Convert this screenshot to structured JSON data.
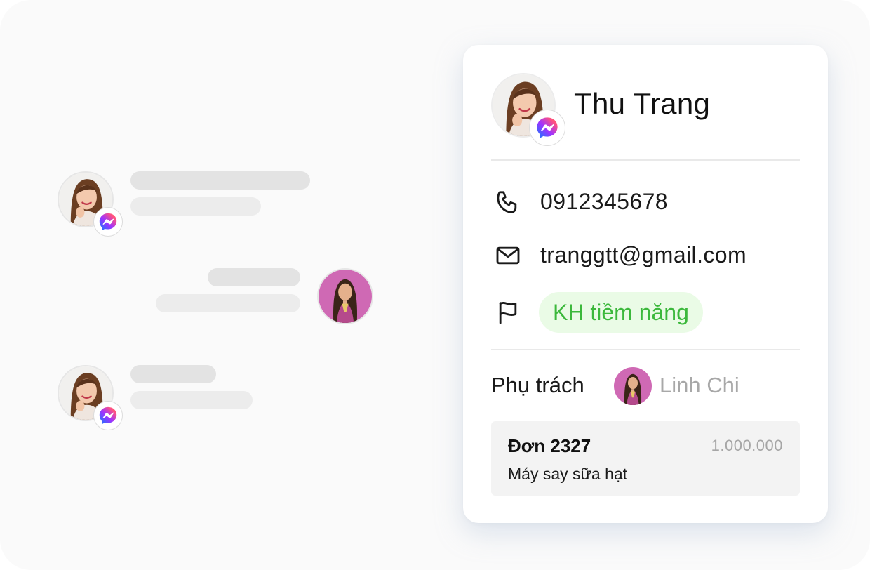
{
  "chat_preview": {
    "messages": [
      {
        "direction": "incoming",
        "channel": "messenger-icon"
      },
      {
        "direction": "outgoing"
      },
      {
        "direction": "incoming",
        "channel": "messenger-icon"
      }
    ]
  },
  "contact": {
    "name": "Thu Trang",
    "channel": "messenger-icon",
    "phone": "0912345678",
    "email": "tranggtt@gmail.com",
    "tag": "KH tiềm năng",
    "tag_color": "#3cb83c",
    "assignee_label": "Phụ trách",
    "assignee_name": "Linh Chi"
  },
  "order": {
    "id": "Đơn 2327",
    "amount": "1.000.000",
    "product": "Máy say sữa hạt"
  },
  "colors": {
    "background": "#fafafa",
    "card": "#ffffff",
    "skeleton": "#e3e3e3",
    "tag_bg": "#eafbe6"
  }
}
